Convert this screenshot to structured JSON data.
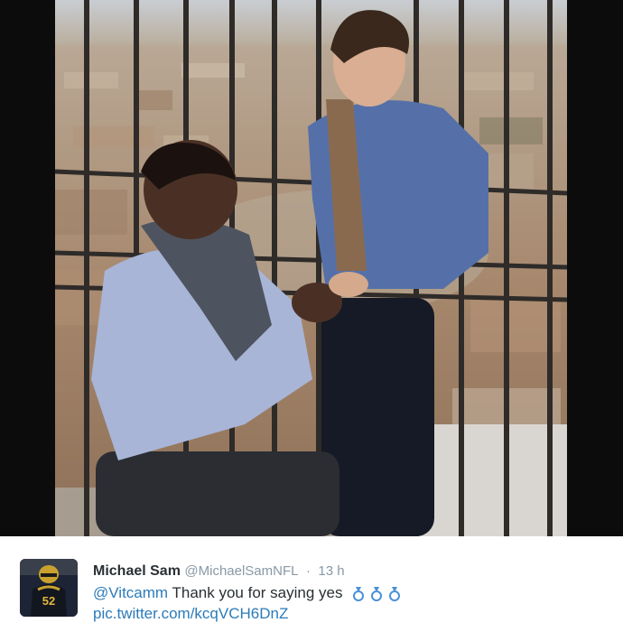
{
  "tweet": {
    "name": "Michael Sam",
    "handle": "@MichaelSamNFL",
    "separator": "·",
    "time": "13 h",
    "mention": "@Vitcamm",
    "text": "Thank you for saying yes",
    "ring_emoji_count": 3,
    "link": "pic.twitter.com/kcqVCH6DnZ",
    "avatar_jersey_number": "52"
  },
  "colors": {
    "link": "#2b7bb9",
    "name": "#292f33",
    "meta": "#8899a6",
    "ring": "#4a90d9"
  },
  "icons": {
    "ring": "ring-icon"
  }
}
